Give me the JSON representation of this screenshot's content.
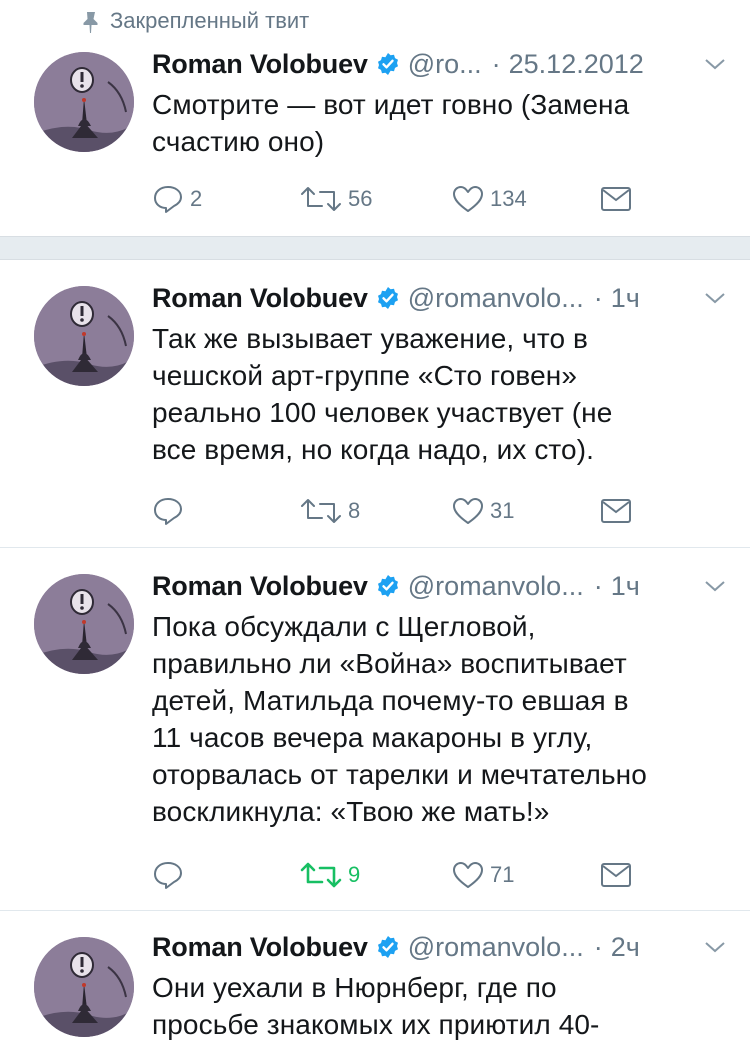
{
  "pinned": {
    "label": "Закрепленный твит"
  },
  "colors": {
    "accent": "#1da1f2",
    "secondary_text": "#657786",
    "retweet_active": "#17bf63"
  },
  "tweets": [
    {
      "author": "Roman Volobuev",
      "handle": "@ro...",
      "time": "25.12.2012",
      "text": "Смотрите — вот идет говно (Замена\nсчастию оно)",
      "replies": "2",
      "retweets": "56",
      "likes": "134"
    },
    {
      "author": "Roman Volobuev",
      "handle": "@romanvolo...",
      "time": "1ч",
      "text": "Так же вызывает уважение, что в\nчешской арт-группе «Сто говен»\nреально 100 человек участвует (не\nвсе время, но когда надо, их сто).",
      "replies": "",
      "retweets": "8",
      "likes": "31"
    },
    {
      "author": "Roman Volobuev",
      "handle": "@romanvolo...",
      "time": "1ч",
      "text": "Пока обсуждали с Щегловой,\nправильно ли «Война» воспитывает\nдетей, Матильда почему-то евшая в\n11 часов вечера макароны в углу,\nоторвалась от тарелки и мечтательно\nвоскликнула: «Твою же мать!»",
      "replies": "",
      "retweets": "9",
      "likes": "71"
    },
    {
      "author": "Roman Volobuev",
      "handle": "@romanvolo...",
      "time": "2ч",
      "text": "Они уехали в Нюрнберг, где по\nпросьбе знакомых их приютил 40-",
      "replies": "",
      "retweets": "",
      "likes": ""
    }
  ]
}
